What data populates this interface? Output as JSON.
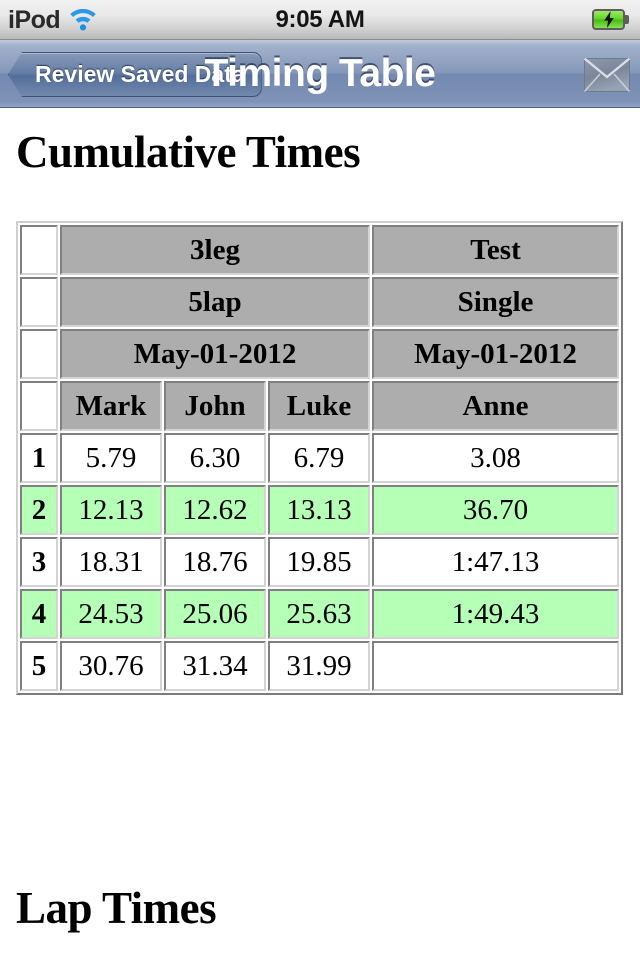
{
  "status_bar": {
    "carrier": "iPod",
    "wifi_icon": "wifi-icon",
    "time": "9:05 AM",
    "battery_icon": "battery-charging-icon"
  },
  "nav_bar": {
    "back_label": "Review Saved Data",
    "title": "Timing Table",
    "mail_icon": "mail-envelope-icon"
  },
  "main": {
    "cumulative_heading": "Cumulative Times",
    "lap_heading": "Lap Times",
    "table": {
      "header_rows": [
        {
          "blank": "",
          "group_a": "3leg",
          "group_b": "Test"
        },
        {
          "blank": "",
          "group_a": "5lap",
          "group_b": "Single"
        },
        {
          "blank": "",
          "group_a": "May-01-2012",
          "group_b": "May-01-2012"
        }
      ],
      "column_headers": {
        "blank": "",
        "names": [
          "Mark",
          "John",
          "Luke"
        ],
        "last": "Anne"
      },
      "rows": [
        {
          "num": "1",
          "values": [
            "5.79",
            "6.30",
            "6.79"
          ],
          "last": "3.08",
          "highlight": false
        },
        {
          "num": "2",
          "values": [
            "12.13",
            "12.62",
            "13.13"
          ],
          "last": "36.70",
          "highlight": true
        },
        {
          "num": "3",
          "values": [
            "18.31",
            "18.76",
            "19.85"
          ],
          "last": "1:47.13",
          "highlight": false
        },
        {
          "num": "4",
          "values": [
            "24.53",
            "25.06",
            "25.63"
          ],
          "last": "1:49.43",
          "highlight": true
        },
        {
          "num": "5",
          "values": [
            "30.76",
            "31.34",
            "31.99"
          ],
          "last": "",
          "highlight": false
        }
      ]
    }
  },
  "colors": {
    "header_gray": "#adadad",
    "highlight_green": "#b6ffb6",
    "nav_blue": "#7489b0",
    "battery_green": "#5fd41f"
  }
}
